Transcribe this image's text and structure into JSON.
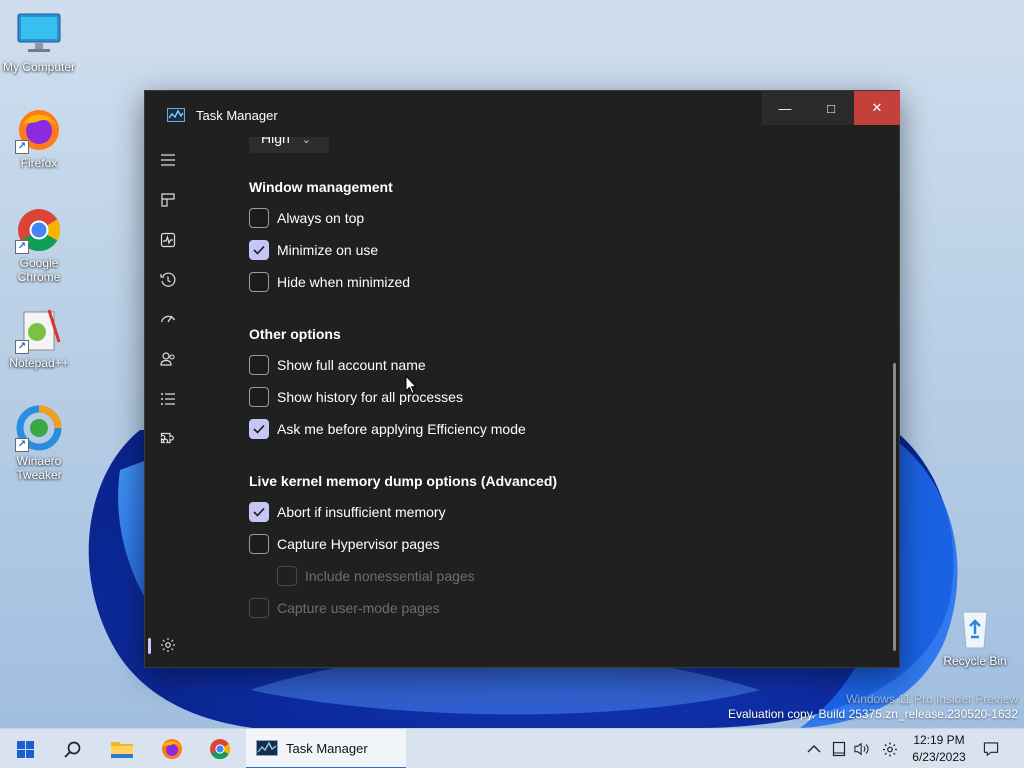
{
  "desktop": {
    "icons": [
      {
        "label": "My Computer",
        "icon": "monitor-icon"
      },
      {
        "label": "Firefox",
        "icon": "firefox-icon"
      },
      {
        "label": "Google Chrome",
        "icon": "chrome-icon"
      },
      {
        "label": "Notepad++",
        "icon": "notepadpp-icon"
      },
      {
        "label": "Winaero Tweaker",
        "icon": "winaero-icon"
      },
      {
        "label": "Recycle Bin",
        "icon": "recycle-bin-icon"
      }
    ],
    "watermark": {
      "line1": "Windows 11 Pro Insider Preview",
      "line2": "Evaluation copy. Build 25375.zn_release.230520-1632"
    }
  },
  "window": {
    "title": "Task Manager",
    "controls": {
      "minimize": "—",
      "maximize": "□",
      "close": "✕"
    },
    "nav_icons": [
      "hamburger-menu-icon",
      "processes-icon",
      "performance-icon",
      "app-history-icon",
      "startup-apps-icon",
      "users-icon",
      "details-icon",
      "services-icon",
      "settings-icon"
    ],
    "partial_dropdown_value": "High",
    "sections": {
      "window_management": {
        "title": "Window management",
        "options": [
          {
            "label": "Always on top",
            "checked": false
          },
          {
            "label": "Minimize on use",
            "checked": true
          },
          {
            "label": "Hide when minimized",
            "checked": false
          }
        ]
      },
      "other_options": {
        "title": "Other options",
        "options": [
          {
            "label": "Show full account name",
            "checked": false
          },
          {
            "label": "Show history for all processes",
            "checked": false
          },
          {
            "label": "Ask me before applying Efficiency mode",
            "checked": true
          }
        ]
      },
      "kernel_dump": {
        "title": "Live kernel memory dump options (Advanced)",
        "options": [
          {
            "label": "Abort if insufficient memory",
            "checked": true,
            "disabled": false
          },
          {
            "label": "Capture Hypervisor pages",
            "checked": false,
            "disabled": false
          },
          {
            "label": "Include nonessential pages",
            "checked": false,
            "disabled": true
          },
          {
            "label": "Capture user-mode pages",
            "checked": false,
            "disabled": true
          }
        ]
      }
    }
  },
  "taskbar": {
    "icons": [
      "start-icon",
      "search-icon",
      "file-explorer-icon",
      "firefox-icon",
      "chrome-icon"
    ],
    "active_app": "Task Manager",
    "tray_icons": [
      "chevron-up-icon",
      "tablet-icon",
      "volume-icon",
      "settings-gear-icon"
    ],
    "time": "12:19 PM",
    "date": "6/23/2023",
    "notification_icon": "notification-icon"
  },
  "colors": {
    "window_bg": "#202020",
    "accent_checkbox": "#c5c6f5",
    "close_button": "#c4403a",
    "taskbar_bg": "#d9e3ef"
  }
}
